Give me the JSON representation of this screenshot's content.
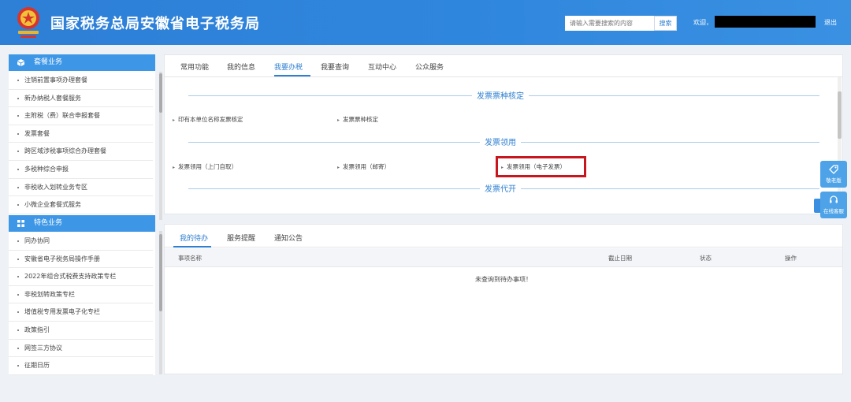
{
  "header": {
    "title": "国家税务总局安徽省电子税务局",
    "search_placeholder": "请输入需要搜索的内容",
    "search_button": "搜索",
    "welcome": "欢迎，",
    "logout": "退出"
  },
  "sidebar": {
    "section1_title": "套餐业务",
    "section1_items": [
      "注销前置事项办理套餐",
      "新办纳税人套餐服务",
      "主附税（费）联合申报套餐",
      "发票套餐",
      "跨区域涉税事项综合办理套餐",
      "多税种综合申报",
      "非税收入划转业务专区",
      "小微企业套餐式服务"
    ],
    "section2_title": "特色业务",
    "section2_items": [
      "同办协同",
      "安徽省电子税务局操作手册",
      "2022年组合式税费支持政策专栏",
      "非税划转政策专栏",
      "增值税专用发票电子化专栏",
      "政策指引",
      "网签三方协议",
      "征期日历"
    ]
  },
  "main": {
    "tabs": [
      "常用功能",
      "我的信息",
      "我要办税",
      "我要查询",
      "互动中心",
      "公众服务"
    ],
    "active_tab": "我要办税",
    "sections": [
      {
        "title": "发票票种核定",
        "links": [
          "印有本单位名称发票核定",
          "发票票种核定"
        ]
      },
      {
        "title": "发票领用",
        "links": [
          "发票领用（上门自取）",
          "发票领用（邮寄）",
          "发票领用（电子发票）"
        ]
      },
      {
        "title": "发票代开",
        "links": []
      }
    ]
  },
  "floating": {
    "elder_mode": "敬老版",
    "online_service": "在线客服"
  },
  "bottom": {
    "tabs": [
      "我的待办",
      "服务提醒",
      "通知公告"
    ],
    "active_tab": "我的待办",
    "columns": [
      "事项名称",
      "截止日期",
      "状态",
      "操作"
    ],
    "empty_message": "未查询到待办事项！"
  },
  "colors": {
    "header_blue": "#2f86dd",
    "accent": "#2f7fd0",
    "highlight_red": "#c8161e"
  }
}
